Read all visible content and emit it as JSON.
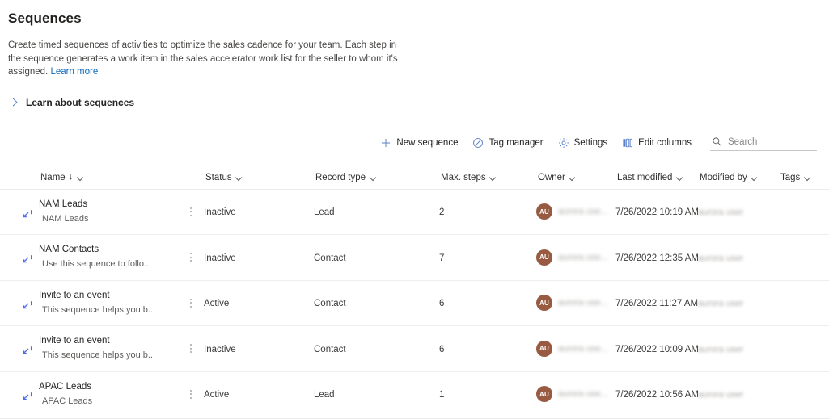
{
  "header": {
    "title": "Sequences",
    "description": "Create timed sequences of activities to optimize the sales cadence for your team. Each step in the sequence generates a work item in the sales accelerator work list for the seller to whom it's assigned.",
    "learn_more": "Learn more"
  },
  "collapsible": {
    "label": "Learn about sequences",
    "expanded": false,
    "chevron_icon": "chevron-right-icon"
  },
  "toolbar": {
    "new_sequence": {
      "label": "New sequence",
      "icon": "plus-icon"
    },
    "tag_manager": {
      "label": "Tag manager",
      "icon": "tag-icon"
    },
    "settings": {
      "label": "Settings",
      "icon": "gear-icon"
    },
    "edit_columns": {
      "label": "Edit columns",
      "icon": "edit-columns-icon"
    },
    "search": {
      "placeholder": "Search",
      "value": "",
      "icon": "search-icon"
    }
  },
  "grid": {
    "columns": [
      {
        "key": "name",
        "label": "Name",
        "sorted": true,
        "sort_arrow": "↓"
      },
      {
        "key": "status",
        "label": "Status"
      },
      {
        "key": "record_type",
        "label": "Record type"
      },
      {
        "key": "max_steps",
        "label": "Max. steps"
      },
      {
        "key": "owner",
        "label": "Owner"
      },
      {
        "key": "last_modified",
        "label": "Last modified"
      },
      {
        "key": "modified_by",
        "label": "Modified by"
      },
      {
        "key": "tags",
        "label": "Tags"
      }
    ],
    "rows": [
      {
        "name": "NAM Leads",
        "subtitle": "NAM Leads",
        "status": "Inactive",
        "record_type": "Lead",
        "max_steps": "2",
        "owner_initials": "AU",
        "owner_name": "aurora use...",
        "last_modified": "7/26/2022 10:19 AM",
        "modified_by": "aurora user",
        "tags": ""
      },
      {
        "name": "NAM Contacts",
        "subtitle": "Use this sequence to follo...",
        "status": "Inactive",
        "record_type": "Contact",
        "max_steps": "7",
        "owner_initials": "AU",
        "owner_name": "aurora use...",
        "last_modified": "7/26/2022 12:35 AM",
        "modified_by": "aurora user",
        "tags": ""
      },
      {
        "name": "Invite to an event",
        "subtitle": "This sequence helps you b...",
        "status": "Active",
        "record_type": "Contact",
        "max_steps": "6",
        "owner_initials": "AU",
        "owner_name": "aurora use...",
        "last_modified": "7/26/2022 11:27 AM",
        "modified_by": "aurora user",
        "tags": ""
      },
      {
        "name": "Invite to an event",
        "subtitle": "This sequence helps you b...",
        "status": "Inactive",
        "record_type": "Contact",
        "max_steps": "6",
        "owner_initials": "AU",
        "owner_name": "aurora use...",
        "last_modified": "7/26/2022 10:09 AM",
        "modified_by": "aurora user",
        "tags": ""
      },
      {
        "name": "APAC Leads",
        "subtitle": "APAC Leads",
        "status": "Active",
        "record_type": "Lead",
        "max_steps": "1",
        "owner_initials": "AU",
        "owner_name": "aurora use...",
        "last_modified": "7/26/2022 10:56 AM",
        "modified_by": "aurora user",
        "tags": ""
      }
    ]
  },
  "colors": {
    "accent": "#0f6cbd",
    "icon_blue": "#5b7fc7",
    "sequence_icon": "#4f6bed",
    "avatar": "#985b41",
    "text": "#242424",
    "subtext": "#605e5c",
    "divider": "#edebe9"
  }
}
